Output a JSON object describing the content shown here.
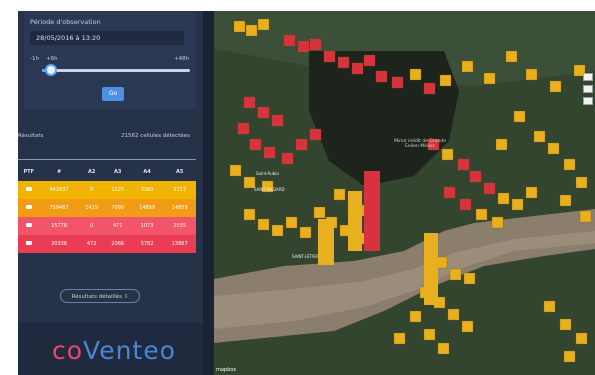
{
  "sidebar": {
    "panel_title": "Période d'observation",
    "date_value": "28/05/2016 à 13:20",
    "range_min_label": "-1h",
    "range_mid_label": "+6h",
    "range_max_label": "+48h",
    "slider_fraction": 0.06,
    "go_label": "Go",
    "results_label": "Résultats",
    "results_count": "21562 cellules détectées",
    "table": {
      "headers": [
        "PTF",
        "#",
        "A2",
        "A3",
        "A4",
        "A5"
      ],
      "rows": [
        {
          "ptf": "building-icon",
          "n": "442837",
          "a2": "0",
          "a3": "1225",
          "a4": "3360",
          "a5": "3717"
        },
        {
          "ptf": "car-icon",
          "n": "759467",
          "a2": "1419",
          "a3": "7090",
          "a4": "14899",
          "a5": "14859"
        },
        {
          "ptf": "building-icon",
          "n": "15778",
          "a2": "0",
          "a3": "471",
          "a4": "1073",
          "a5": "2035"
        },
        {
          "ptf": "car-icon",
          "n": "20336",
          "a2": "472",
          "a3": "2066",
          "a4": "5782",
          "a5": "13867"
        }
      ]
    },
    "detail_label": "Résultats détaillés",
    "logo_co": "co",
    "logo_rest": "Venteo"
  },
  "map": {
    "note": "Miroir inédit de Grande Eolien Médoc",
    "labels": [
      "Saint-Aubin",
      "SAINT-MEDARD",
      "SAINT-LÉTIER"
    ],
    "attribution": "mapbox"
  },
  "colors": {
    "panel_bg": "#263248",
    "yellow": "#f0b400",
    "orange": "#f29b14",
    "red": "#f2546a",
    "accent": "#4d8fe0",
    "map_yellow": "#e8b01e",
    "map_red": "#d8323f"
  }
}
